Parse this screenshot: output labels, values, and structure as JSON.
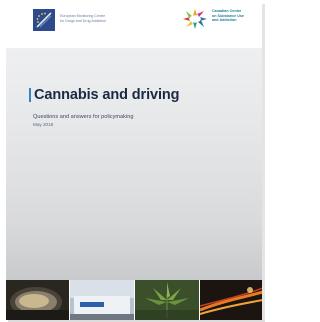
{
  "header": {
    "left_logo": {
      "icon": "emcdda-eu-stars-icon",
      "lines": [
        "European Monitoring Centre",
        "for Drugs and Drug Addiction"
      ],
      "color": "#2c4a8c"
    },
    "right_logo": {
      "icon": "ccsa-star-icon",
      "lines": [
        "Canadian Centre",
        "on Substance Use",
        "and Addiction"
      ],
      "color": "#1f7f8f"
    }
  },
  "cover": {
    "title": "Cannabis and driving",
    "subtitle": "Questions and answers for policymaking",
    "date": "May 2018",
    "accent_color": "#3b7fc4"
  },
  "photos": [
    {
      "name": "car-mirror-photo"
    },
    {
      "name": "police-car-photo"
    },
    {
      "name": "cannabis-plant-photo"
    },
    {
      "name": "night-traffic-photo"
    }
  ]
}
